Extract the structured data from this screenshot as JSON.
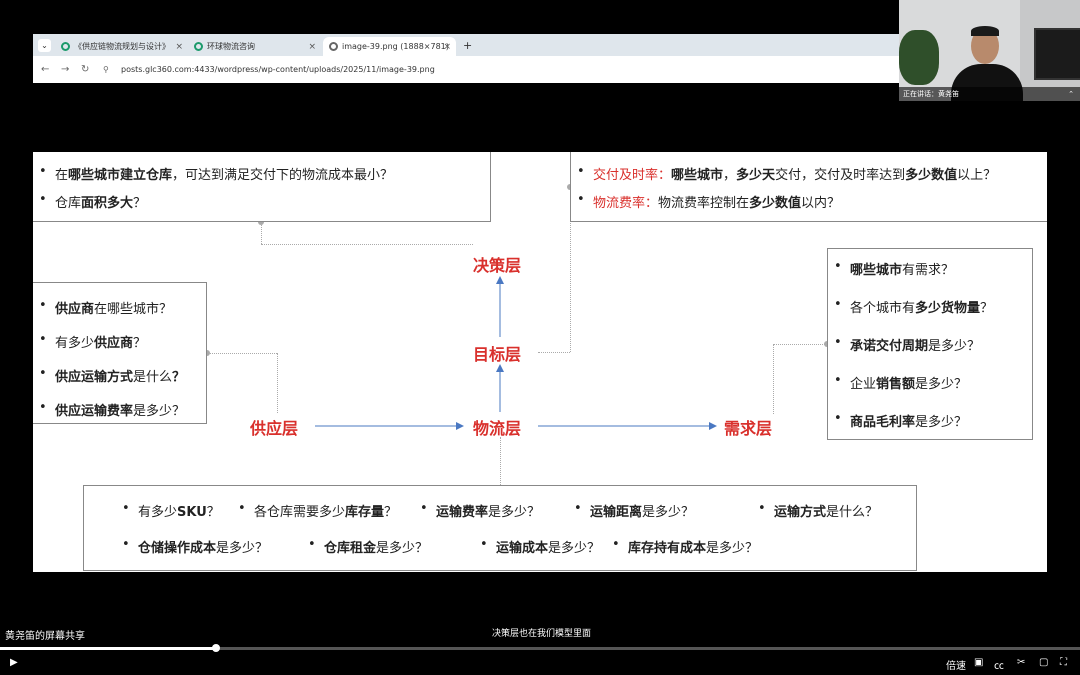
{
  "browser": {
    "tabs": [
      {
        "title": "《供应链物流规划与设计》"
      },
      {
        "title": "环球物流咨询"
      },
      {
        "title": "image-39.png (1888×781)"
      }
    ],
    "add_tab": "+",
    "url": "posts.glc360.com:4433/wordpress/wp-content/uploads/2025/11/image-39.png"
  },
  "camera": {
    "speaker_label": "正在讲话：黄尧笛"
  },
  "slide": {
    "top_left": [
      [
        {
          "t": "在"
        },
        {
          "t": "哪些城市建立仓库",
          "b": true
        },
        {
          "t": "，可达到满足交付下的物流成本最小？"
        }
      ],
      [
        {
          "t": "仓库"
        },
        {
          "t": "面积多大",
          "b": true
        },
        {
          "t": "？"
        }
      ]
    ],
    "top_right": [
      [
        {
          "t": "交付及时率：",
          "red": true
        },
        {
          "t": "哪些城市",
          "b": true
        },
        {
          "t": "，"
        },
        {
          "t": "多少天",
          "b": true
        },
        {
          "t": "交付，交付及时率达到"
        },
        {
          "t": "多少数值",
          "b": true
        },
        {
          "t": "以上？"
        }
      ],
      [
        {
          "t": "物流费率：",
          "red": true
        },
        {
          "t": "物流费率控制在"
        },
        {
          "t": "多少数值",
          "b": true
        },
        {
          "t": "以内？"
        }
      ]
    ],
    "left_box": [
      [
        {
          "t": "供应商",
          "b": true
        },
        {
          "t": "在哪些城市？"
        }
      ],
      [
        {
          "t": "有多少"
        },
        {
          "t": "供应商",
          "b": true
        },
        {
          "t": "？"
        }
      ],
      [
        {
          "t": "供应运输方式",
          "b": true
        },
        {
          "t": "是什么"
        },
        {
          "t": "？",
          "b": true
        }
      ],
      [
        {
          "t": "供应运输费率",
          "b": true
        },
        {
          "t": "是多少？"
        }
      ]
    ],
    "right_box": [
      [
        {
          "t": "哪些城市",
          "b": true
        },
        {
          "t": "有需求？"
        }
      ],
      [
        {
          "t": "各个城市有"
        },
        {
          "t": "多少货物量",
          "b": true
        },
        {
          "t": "？"
        }
      ],
      [
        {
          "t": "承诺交付周期",
          "b": true
        },
        {
          "t": "是多少？"
        }
      ],
      [
        {
          "t": "企业"
        },
        {
          "t": "销售额",
          "b": true
        },
        {
          "t": "是多少？"
        }
      ],
      [
        {
          "t": "商品毛利率",
          "b": true
        },
        {
          "t": "是多少？"
        }
      ]
    ],
    "bottom_row1": [
      [
        {
          "t": "有多少"
        },
        {
          "t": "SKU",
          "b": true
        },
        {
          "t": "？"
        }
      ],
      [
        {
          "t": "各仓库需要多少"
        },
        {
          "t": "库存量",
          "b": true
        },
        {
          "t": "？"
        }
      ],
      [
        {
          "t": "运输费率",
          "b": true
        },
        {
          "t": "是多少？"
        }
      ],
      [
        {
          "t": "运输距离",
          "b": true
        },
        {
          "t": "是多少？"
        }
      ],
      [
        {
          "t": "运输方式",
          "b": true
        },
        {
          "t": "是什么？"
        }
      ]
    ],
    "bottom_row2": [
      [
        {
          "t": "仓储操作成本",
          "b": true
        },
        {
          "t": "是多少？"
        }
      ],
      [
        {
          "t": "仓库租金",
          "b": true
        },
        {
          "t": "是多少？"
        }
      ],
      [
        {
          "t": "运输成本",
          "b": true
        },
        {
          "t": "是多少？"
        }
      ],
      [
        {
          "t": "库存持有成本",
          "b": true
        },
        {
          "t": "是多少？"
        }
      ]
    ],
    "nodes": {
      "decision": "决策层",
      "goal": "目标层",
      "supply": "供应层",
      "logistics": "物流层",
      "demand": "需求层"
    },
    "accent_color": "#d9302c",
    "arrow_color": "#4a78c2"
  },
  "meeting": {
    "share_caption": "黄尧笛的屏幕共享",
    "subtitle": "决策层也在我们模型里面",
    "speed_label": "倍速",
    "progress": 0.2
  }
}
